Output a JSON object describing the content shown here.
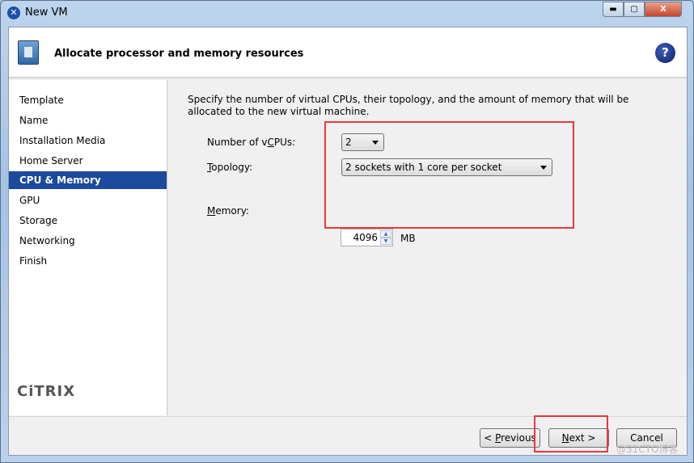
{
  "window": {
    "title": "New VM",
    "icon": "xencenter-x-icon",
    "controls": [
      "minimize",
      "maximize",
      "close"
    ]
  },
  "header": {
    "title": "Allocate processor and memory resources",
    "icon": "vm-wizard-icon",
    "help": "?"
  },
  "sidebar": {
    "items": [
      {
        "label": "Template",
        "active": false
      },
      {
        "label": "Name",
        "active": false
      },
      {
        "label": "Installation Media",
        "active": false
      },
      {
        "label": "Home Server",
        "active": false
      },
      {
        "label": "CPU & Memory",
        "active": true
      },
      {
        "label": "GPU",
        "active": false
      },
      {
        "label": "Storage",
        "active": false
      },
      {
        "label": "Networking",
        "active": false
      },
      {
        "label": "Finish",
        "active": false
      }
    ],
    "logo": "CiTRIX"
  },
  "main": {
    "description": "Specify the number of virtual CPUs, their topology, and the amount of memory that will be allocated to the new virtual machine.",
    "vcpus": {
      "label_pre": "Number of v",
      "label_u": "C",
      "label_post": "PUs:",
      "value": "2"
    },
    "topology": {
      "label_u": "T",
      "label_post": "opology:",
      "value": "2 sockets with 1 core per socket"
    },
    "memory": {
      "label_u": "M",
      "label_post": "emory:",
      "value": "4096",
      "unit": "MB"
    }
  },
  "buttons": {
    "previous_pre": "< ",
    "previous_u": "P",
    "previous_post": "revious",
    "next_u": "N",
    "next_post": "ext >",
    "cancel": "Cancel"
  },
  "highlight_color": "#e8383c",
  "watermark": "@51CTO博客"
}
